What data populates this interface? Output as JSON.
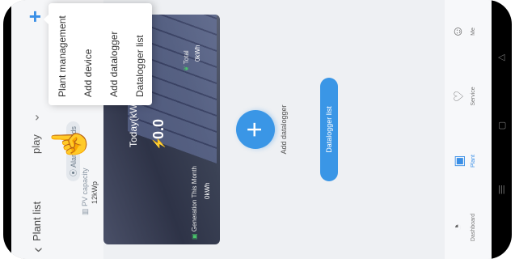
{
  "header": {
    "back_label": "Plant list",
    "plant_name": "play",
    "add_glyph": "+"
  },
  "plant": {
    "location": "Alandislands",
    "pv_capacity_label": "PV capacity",
    "pv_capacity_value": "12kWp"
  },
  "hero": {
    "today_label": "Today(kWh)",
    "today_value": "0.0",
    "month_label": "Generation This Month",
    "month_value": "0kWh",
    "total_label": "Total",
    "total_value": "0kWh"
  },
  "menu": {
    "items": [
      "Plant management",
      "Add device",
      "Add datalogger",
      "Datalogger list"
    ]
  },
  "main": {
    "add_datalogger_label": "Add datalogger",
    "datalogger_list_button": "Datalogger list"
  },
  "tabs": [
    {
      "label": "Dashboard",
      "icon": "dashboard-icon",
      "active": false
    },
    {
      "label": "Plant",
      "icon": "plant-icon",
      "active": true
    },
    {
      "label": "Service",
      "icon": "service-icon",
      "active": false
    },
    {
      "label": "Me",
      "icon": "me-icon",
      "active": false
    }
  ],
  "colors": {
    "accent": "#3a8fe6",
    "energy_green": "#49c46a"
  }
}
